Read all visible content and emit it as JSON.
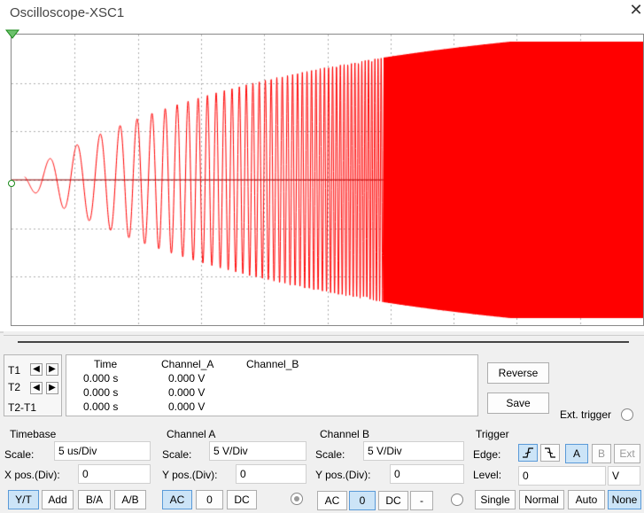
{
  "window": {
    "title": "Oscilloscope-XSC1",
    "close_glyph": "✕"
  },
  "colors": {
    "trace": "#ff0000",
    "grid": "#b0b0b0",
    "marker": "#1b8a1b"
  },
  "readout": {
    "rows": [
      {
        "label": "T1"
      },
      {
        "label": "T2"
      },
      {
        "label": "T2-T1"
      }
    ],
    "headers": {
      "time": "Time",
      "cha": "Channel_A",
      "chb": "Channel_B"
    },
    "values": [
      {
        "time": "0.000 s",
        "cha": "0.000 V",
        "chb": ""
      },
      {
        "time": "0.000 s",
        "cha": "0.000 V",
        "chb": ""
      },
      {
        "time": "0.000 s",
        "cha": "0.000 V",
        "chb": ""
      }
    ],
    "reverse_label": "Reverse",
    "save_label": "Save",
    "ext_trigger_label": "Ext. trigger"
  },
  "timebase": {
    "title": "Timebase",
    "scale_label": "Scale:",
    "scale_value": "5 us/Div",
    "xpos_label": "X pos.(Div):",
    "xpos_value": "0",
    "modes": [
      "Y/T",
      "Add",
      "B/A",
      "A/B"
    ],
    "selected_mode": "Y/T"
  },
  "channel_a": {
    "title": "Channel A",
    "scale_label": "Scale:",
    "scale_value": "5  V/Div",
    "ypos_label": "Y pos.(Div):",
    "ypos_value": "0",
    "couplings": [
      "AC",
      "0",
      "DC"
    ],
    "selected": "AC"
  },
  "channel_b": {
    "title": "Channel B",
    "scale_label": "Scale:",
    "scale_value": "5  V/Div",
    "ypos_label": "Y pos.(Div):",
    "ypos_value": "0",
    "couplings": [
      "AC",
      "0",
      "DC",
      "-"
    ],
    "selected": "0"
  },
  "trigger": {
    "title": "Trigger",
    "edge_label": "Edge:",
    "level_label": "Level:",
    "level_value": "0",
    "level_unit": "V",
    "sources": [
      "A",
      "B",
      "Ext"
    ],
    "selected_source": "A",
    "modes": [
      "Single",
      "Normal",
      "Auto",
      "None"
    ],
    "selected_mode": "None"
  }
}
